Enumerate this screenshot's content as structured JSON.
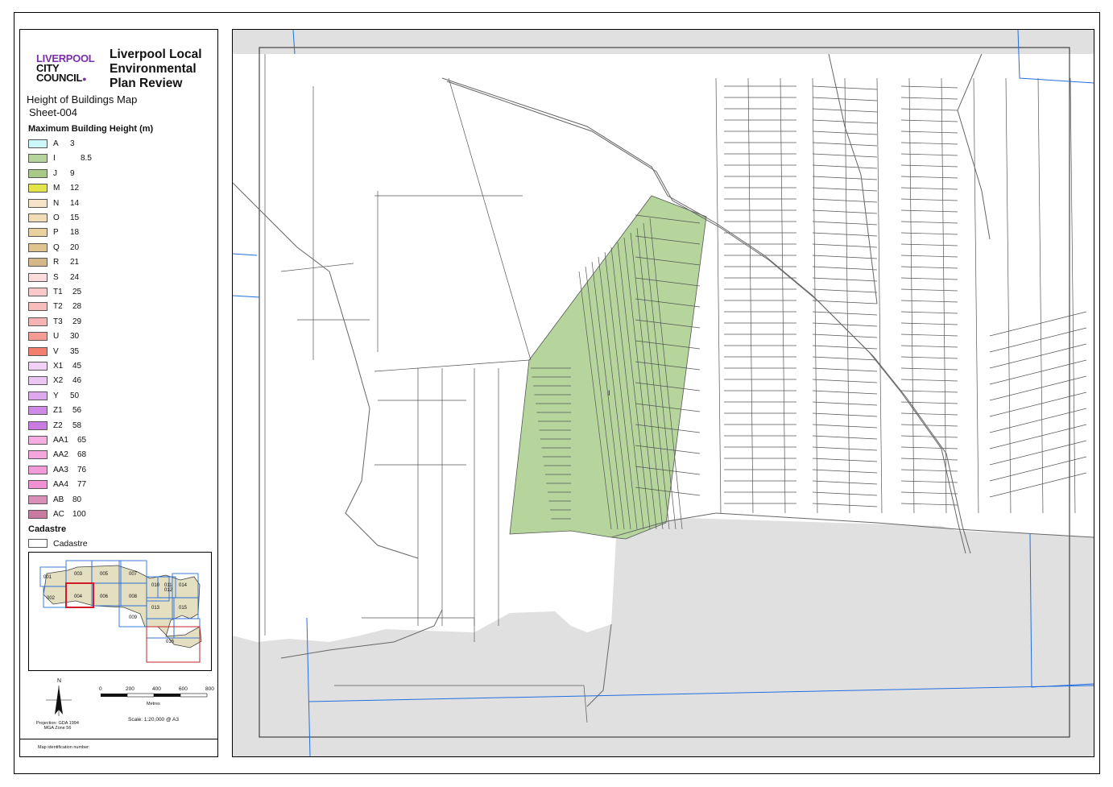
{
  "header": {
    "logo_line1": "LIVERPOOL",
    "logo_line2": "CITY",
    "logo_line3": "COUNCIL",
    "plan_title": "Liverpool Local Environmental Plan Review",
    "map_name": "Height of Buildings Map",
    "sheet": "Sheet-004"
  },
  "legend": {
    "heading": "Maximum Building Height (m)",
    "items": [
      {
        "code": "A",
        "value": "3",
        "color": "#cdf6f8"
      },
      {
        "code": "I",
        "value": "8.5",
        "color": "#b5d59c"
      },
      {
        "code": "J",
        "value": "9",
        "color": "#a7cb86"
      },
      {
        "code": "M",
        "value": "12",
        "color": "#e3e34a"
      },
      {
        "code": "N",
        "value": "14",
        "color": "#f6e4c8"
      },
      {
        "code": "O",
        "value": "15",
        "color": "#f0dcb6"
      },
      {
        "code": "P",
        "value": "18",
        "color": "#e8d19c"
      },
      {
        "code": "Q",
        "value": "20",
        "color": "#dfc48f"
      },
      {
        "code": "R",
        "value": "21",
        "color": "#d5b888"
      },
      {
        "code": "S",
        "value": "24",
        "color": "#fbdcdc"
      },
      {
        "code": "T1",
        "value": "25",
        "color": "#f9c8c8"
      },
      {
        "code": "T2",
        "value": "28",
        "color": "#f7bcbc"
      },
      {
        "code": "T3",
        "value": "29",
        "color": "#f6b3b3"
      },
      {
        "code": "U",
        "value": "30",
        "color": "#f59c94"
      },
      {
        "code": "V",
        "value": "35",
        "color": "#f47e6e"
      },
      {
        "code": "X1",
        "value": "45",
        "color": "#f1d1f5"
      },
      {
        "code": "X2",
        "value": "46",
        "color": "#ecc6f3"
      },
      {
        "code": "Y",
        "value": "50",
        "color": "#dda8ee"
      },
      {
        "code": "Z1",
        "value": "56",
        "color": "#cf8ae8"
      },
      {
        "code": "Z2",
        "value": "58",
        "color": "#c97ae3"
      },
      {
        "code": "AA1",
        "value": "65",
        "color": "#f6aee0"
      },
      {
        "code": "AA2",
        "value": "68",
        "color": "#f4a5dc"
      },
      {
        "code": "AA3",
        "value": "76",
        "color": "#f39ad8"
      },
      {
        "code": "AA4",
        "value": "77",
        "color": "#f091d3"
      },
      {
        "code": "AB",
        "value": "80",
        "color": "#d990b8"
      },
      {
        "code": "AC",
        "value": "100",
        "color": "#c97a9f"
      }
    ],
    "cadastre_heading": "Cadastre",
    "cadastre_label": "Cadastre"
  },
  "inset": {
    "tiles": [
      "001",
      "002",
      "003",
      "004",
      "005",
      "006",
      "007",
      "008",
      "009",
      "010",
      "011",
      "012",
      "013",
      "014",
      "015",
      "016"
    ],
    "highlighted_tile": "004"
  },
  "north_label": "N",
  "scale": {
    "ticks": [
      "0",
      "200",
      "400",
      "600",
      "800"
    ],
    "unit": "Metres",
    "text": "Scale: 1:20,000 @ A3"
  },
  "projection": {
    "line1": "Projection: GDA 1994",
    "line2": "MGA Zone 56"
  },
  "map_id_label": "Map identification number:",
  "map": {
    "zone_label": "I",
    "zone_color": "#b5d59c",
    "background": "#e0e0e0",
    "land_color": "#ffffff",
    "grid_color": "#1f6fe0"
  }
}
